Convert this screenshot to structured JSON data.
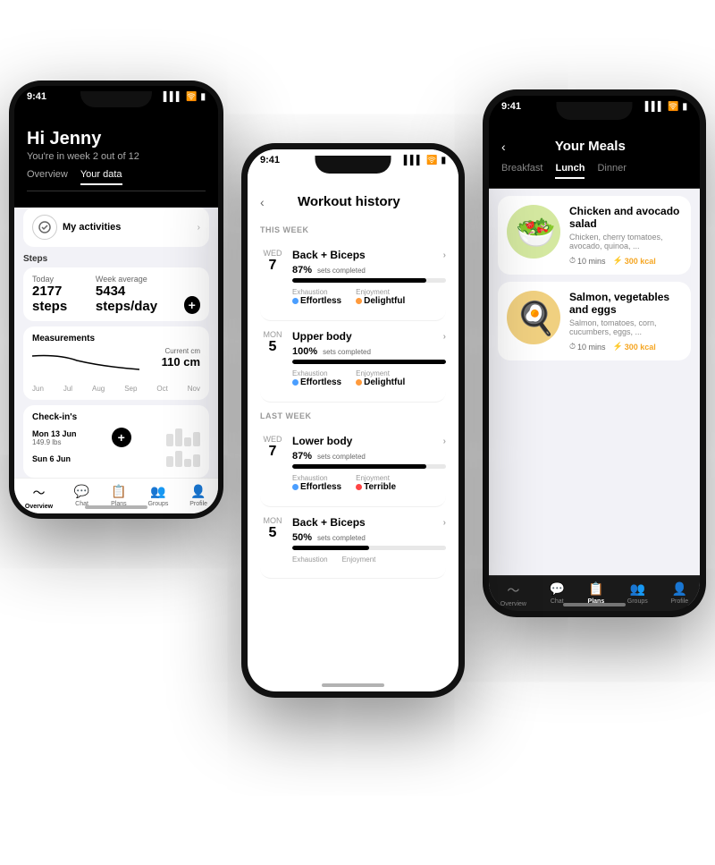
{
  "phone_left": {
    "status_time": "9:41",
    "greeting": "Hi Jenny",
    "subtitle": "You're in week 2 out of 12",
    "tabs": [
      "Overview",
      "Your data"
    ],
    "active_tab": "Your data",
    "activities_label": "My activities",
    "steps_section": "Steps",
    "today_label": "Today",
    "today_value": "2177 steps",
    "week_avg_label": "Week average",
    "week_avg_value": "5434 steps/day",
    "measurements_label": "Measurements",
    "current_label": "Current cm",
    "current_value": "110 cm",
    "months": [
      "Jun",
      "Jul",
      "Aug",
      "Sep",
      "Oct",
      "Nov"
    ],
    "checkins_label": "Check-in's",
    "checkin1_date": "Mon 13 Jun",
    "checkin1_weight": "149.9 lbs",
    "checkin2_date": "Sun 6 Jun",
    "nav": [
      {
        "icon": "〜",
        "label": "Overview",
        "active": true
      },
      {
        "icon": "💬",
        "label": "Chat",
        "active": false
      },
      {
        "icon": "📋",
        "label": "Plans",
        "active": false
      },
      {
        "icon": "👥",
        "label": "Groups",
        "active": false
      },
      {
        "icon": "👤",
        "label": "Profile",
        "active": false
      }
    ]
  },
  "phone_center": {
    "status_time": "9:41",
    "title": "Workout history",
    "this_week_label": "THIS WEEK",
    "last_week_label": "LAST WEEK",
    "workouts_this_week": [
      {
        "day_name": "WED",
        "day_num": "7",
        "name": "Back + Biceps",
        "pct": "87%",
        "sets_label": "sets completed",
        "progress": 87,
        "exhaustion_label": "Exhaustion",
        "exhaustion_val": "Effortless",
        "enjoyment_label": "Enjoyment",
        "enjoyment_val": "Delightful"
      },
      {
        "day_name": "MON",
        "day_num": "5",
        "name": "Upper body",
        "pct": "100%",
        "sets_label": "sets completed",
        "progress": 100,
        "exhaustion_label": "Exhaustion",
        "exhaustion_val": "Effortless",
        "enjoyment_label": "Enjoyment",
        "enjoyment_val": "Delightful"
      }
    ],
    "workouts_last_week": [
      {
        "day_name": "WED",
        "day_num": "7",
        "name": "Lower body",
        "pct": "87%",
        "sets_label": "sets completed",
        "progress": 87,
        "exhaustion_label": "Exhaustion",
        "exhaustion_val": "Effortless",
        "enjoyment_label": "Enjoyment",
        "enjoyment_val": "Terrible"
      },
      {
        "day_name": "MON",
        "day_num": "5",
        "name": "Back + Biceps",
        "pct": "50%",
        "sets_label": "sets completed",
        "progress": 50,
        "exhaustion_label": "Exhaustion",
        "exhaustion_val": "",
        "enjoyment_label": "Enjoyment",
        "enjoyment_val": ""
      }
    ],
    "nav": [
      {
        "icon": "〜",
        "label": "Overview"
      },
      {
        "icon": "💬",
        "label": "Chat"
      },
      {
        "icon": "📋",
        "label": "Plans"
      },
      {
        "icon": "👥",
        "label": "Groups"
      },
      {
        "icon": "👤",
        "label": "Profile"
      }
    ]
  },
  "phone_right": {
    "status_time": "9:41",
    "title": "Your Meals",
    "tabs": [
      "Breakfast",
      "Lunch",
      "Dinner"
    ],
    "active_tab": "Lunch",
    "meals": [
      {
        "name": "Chicken and avocado salad",
        "desc": "Chicken, cherry tomatoes, avocado, quinoa, ...",
        "time": "10 mins",
        "kcal": "300 kcal"
      },
      {
        "name": "Salmon, vegetables and eggs",
        "desc": "Salmon, tomatoes, corn, cucumbers, eggs, ...",
        "time": "10 mins",
        "kcal": "300 kcal"
      }
    ],
    "nav": [
      {
        "icon": "〜",
        "label": "Overview"
      },
      {
        "icon": "💬",
        "label": "Chat"
      },
      {
        "icon": "📋",
        "label": "Plans",
        "active": true
      },
      {
        "icon": "👥",
        "label": "Groups"
      },
      {
        "icon": "👤",
        "label": "Profile"
      }
    ]
  }
}
